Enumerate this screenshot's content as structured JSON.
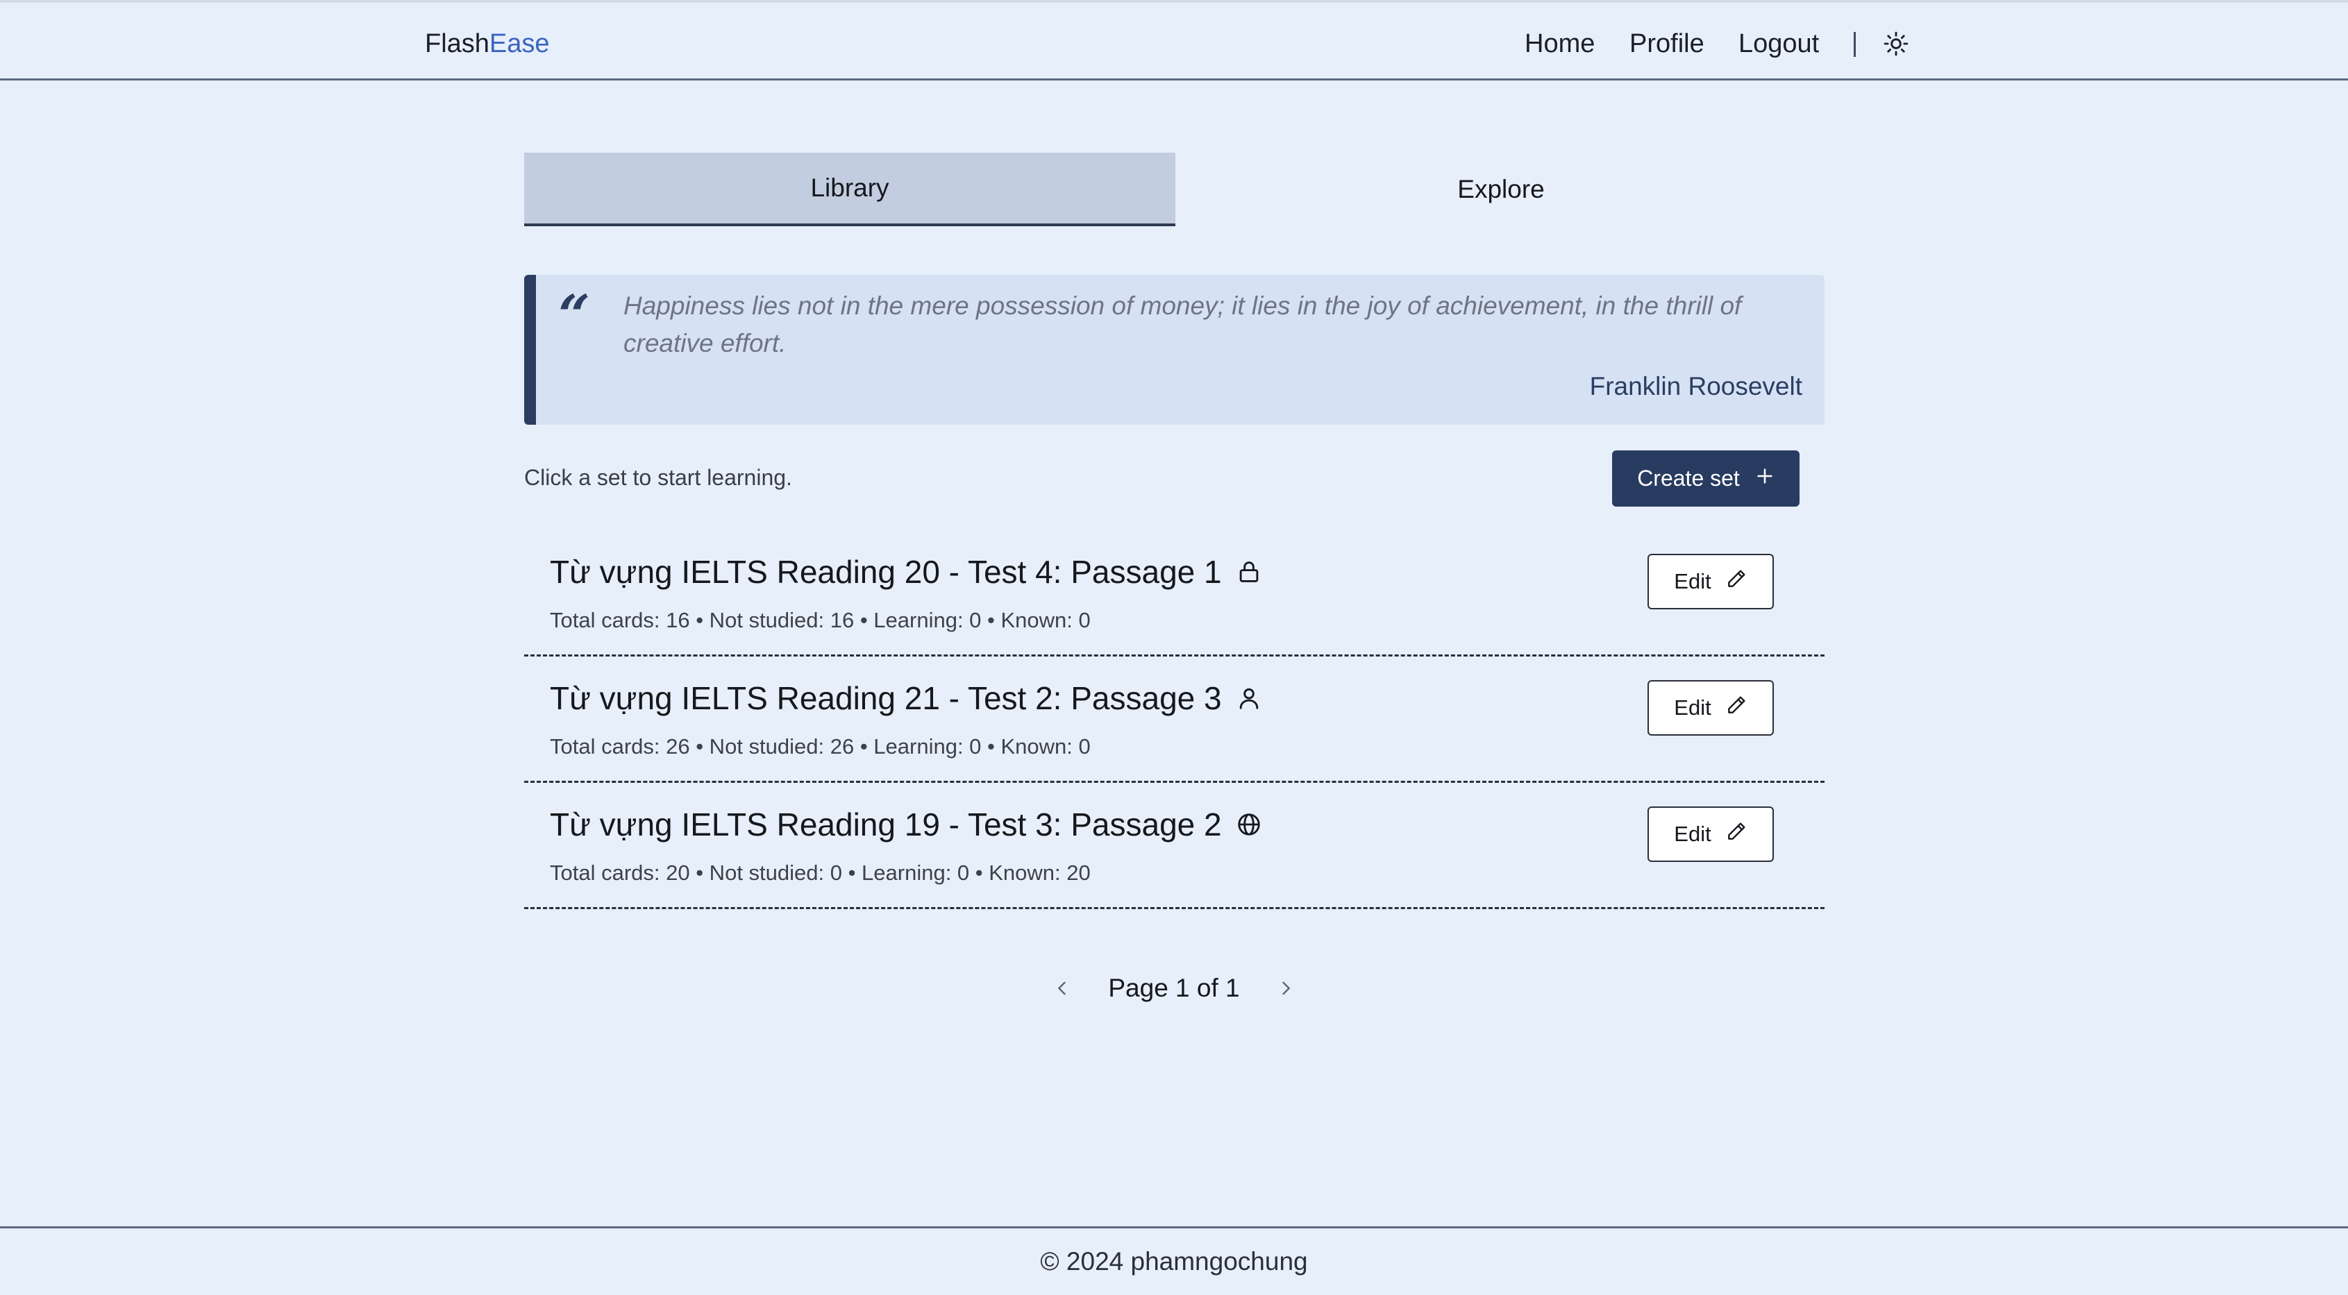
{
  "header": {
    "brand_primary": "Flash",
    "brand_accent": "Ease",
    "brand_accent_color": "#3b63bf",
    "nav": {
      "home": "Home",
      "profile": "Profile",
      "logout": "Logout"
    },
    "theme_toggle_icon": "sun-icon"
  },
  "tabs": {
    "library": "Library",
    "explore": "Explore",
    "active": "Library"
  },
  "quote": {
    "text": "Happiness lies not in the mere possession of money; it lies in the joy of achievement, in the thrill of creative effort.",
    "author": "Franklin Roosevelt"
  },
  "toolbar": {
    "hint": "Click a set to start learning.",
    "create_label": "Create set",
    "create_icon": "plus-icon"
  },
  "sets": [
    {
      "title": "Từ vựng IELTS Reading 20 - Test 4: Passage 1",
      "visibility_icon": "lock-icon",
      "stats": "Total cards: 16 • Not studied: 16 • Learning: 0 • Known: 0",
      "edit_label": "Edit"
    },
    {
      "title": "Từ vựng IELTS Reading 21 - Test 2: Passage 3",
      "visibility_icon": "user-icon",
      "stats": "Total cards: 26 • Not studied: 26 • Learning: 0 • Known: 0",
      "edit_label": "Edit"
    },
    {
      "title": "Từ vựng IELTS Reading 19 - Test 3: Passage 2",
      "visibility_icon": "globe-icon",
      "stats": "Total cards: 20 • Not studied: 0 • Learning: 0 • Known: 20",
      "edit_label": "Edit"
    }
  ],
  "pagination": {
    "text": "Page 1 of 1"
  },
  "footer": {
    "text": "© 2024 phamngochung"
  },
  "colors": {
    "background": "#e7effb",
    "primary": "#283b60",
    "active_tab": "#c3cde0",
    "quote_bg": "#d6e1f3"
  }
}
